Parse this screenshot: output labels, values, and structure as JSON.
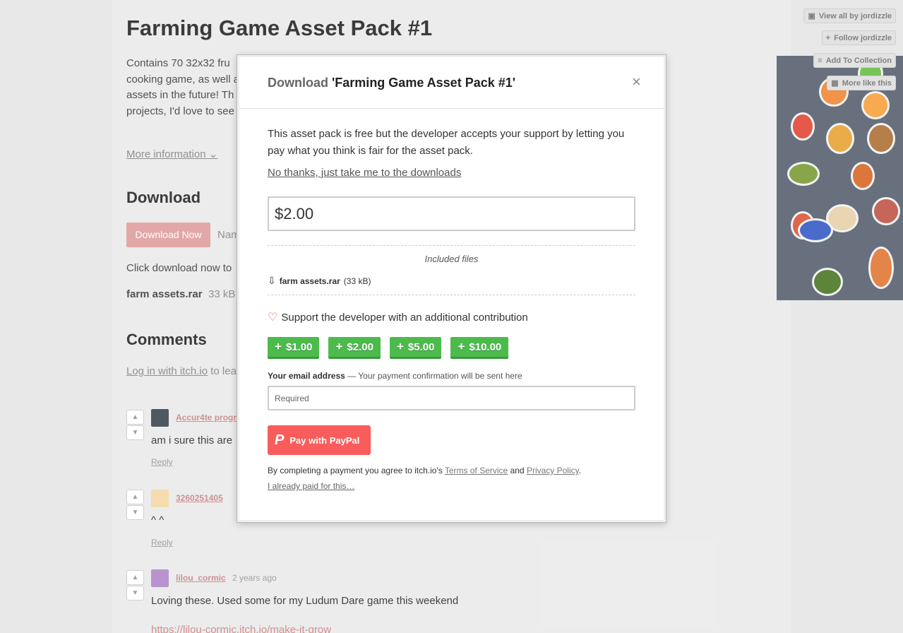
{
  "page": {
    "title": "Farming Game Asset Pack #1",
    "description": "Contains 70 32x32 fru cooking game, as well a assets in the future! Th projects, I'd love to see",
    "more_info": "More information",
    "more_info_icon": "chevron-down-icon",
    "download_heading": "Download",
    "download_button": "Download Now",
    "name_fragment": "Nam",
    "click_fragment": "Click download now to",
    "file_name": "farm assets.rar",
    "file_size": "33 kB",
    "comments_heading": "Comments",
    "login_link": "Log in with itch.io",
    "login_suffix": " to lea"
  },
  "sidebar": {
    "view_all": "View all by jordizzle",
    "follow": "Follow jordizzle",
    "add_collection": "Add To Collection",
    "more_like": "More like this"
  },
  "comments": [
    {
      "user": "Accur4te progr",
      "time": "",
      "body": "am i sure this are",
      "reply": "Reply"
    },
    {
      "user": "3260251405",
      "time": "",
      "body": "^ ^",
      "reply": "Reply"
    },
    {
      "user": "lilou_cormic",
      "time": "2 years ago",
      "body": "Loving these. Used some for my Ludum Dare game this weekend",
      "reply": "",
      "link": "https://lilou-cormic.itch.io/make-it-grow"
    }
  ],
  "modal": {
    "title_label": "Download",
    "title_name": "'Farming Game Asset Pack #1'",
    "close_icon": "×",
    "text": "This asset pack is free but the developer accepts your support by letting you pay what you think is fair for the asset pack.",
    "no_thanks": "No thanks, just take me to the downloads",
    "price_value": "$2.00",
    "included_files": "Included files",
    "file_name": "farm assets.rar",
    "file_size": "(33 kB)",
    "support_text": "Support the developer with an additional contribution",
    "tips": [
      "$1.00",
      "$2.00",
      "$5.00",
      "$10.00"
    ],
    "email_label": "Your email address",
    "email_hint": " — Your payment confirmation will be sent here",
    "email_placeholder": "Required",
    "paypal": "Pay with PayPal",
    "terms_prefix": "By completing a payment you agree to itch.io's ",
    "terms_link": "Terms of Service",
    "terms_and": " and ",
    "privacy_link": "Privacy Policy",
    "terms_suffix": ".",
    "already_paid": "I already paid for this…"
  },
  "colors": {
    "accent": "#fa5c5c",
    "tip_green": "#4cbb4c"
  }
}
